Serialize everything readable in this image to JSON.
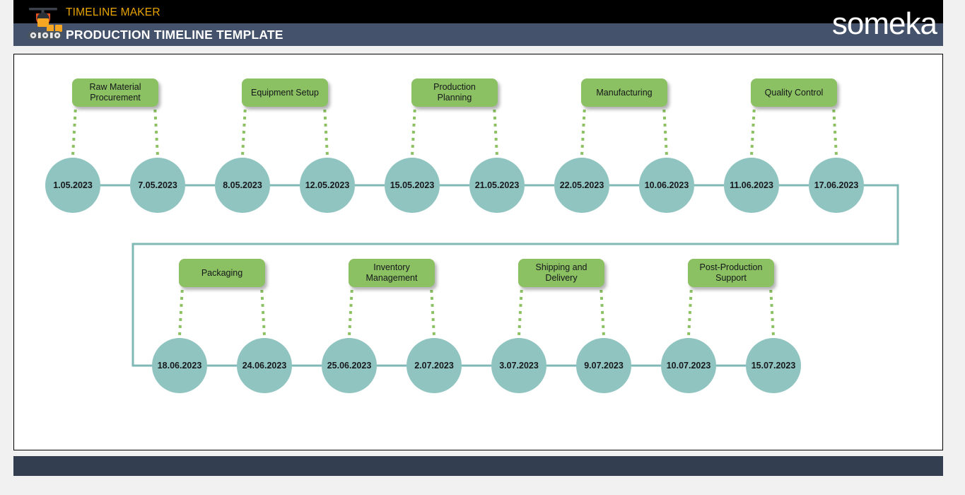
{
  "header": {
    "brand_kicker": "TIMELINE MAKER",
    "title": "PRODUCTION TIMELINE TEMPLATE",
    "wordmark_pre": "s",
    "wordmark_o": "o",
    "wordmark_post": "meka",
    "logo_icon": "factory-crane-icon",
    "chart_icon": "bar-chart-icon",
    "colors": {
      "kicker": "#e8a400",
      "black_band": "#000000",
      "slate_band": "#44536b",
      "footer": "#333f51"
    }
  },
  "timeline": {
    "colors": {
      "node_fill": "#8fc4c0",
      "milestone_fill": "#8cc163",
      "connector": "#7fb9b5",
      "dotted": "#8cc163"
    },
    "rows": [
      {
        "nodes": [
          {
            "date": "1.05.2023"
          },
          {
            "date": "7.05.2023"
          },
          {
            "date": "8.05.2023"
          },
          {
            "date": "12.05.2023"
          },
          {
            "date": "15.05.2023"
          },
          {
            "date": "21.05.2023"
          },
          {
            "date": "22.05.2023"
          },
          {
            "date": "10.06.2023"
          },
          {
            "date": "11.06.2023"
          },
          {
            "date": "17.06.2023"
          }
        ],
        "milestones": [
          {
            "label": "Raw Material Procurement",
            "start": 0,
            "end": 1
          },
          {
            "label": "Equipment Setup",
            "start": 2,
            "end": 3
          },
          {
            "label": "Production Planning",
            "start": 4,
            "end": 5
          },
          {
            "label": "Manufacturing",
            "start": 6,
            "end": 7
          },
          {
            "label": "Quality Control",
            "start": 8,
            "end": 9
          }
        ]
      },
      {
        "nodes": [
          {
            "date": "18.06.2023"
          },
          {
            "date": "24.06.2023"
          },
          {
            "date": "25.06.2023"
          },
          {
            "date": "2.07.2023"
          },
          {
            "date": "3.07.2023"
          },
          {
            "date": "9.07.2023"
          },
          {
            "date": "10.07.2023"
          },
          {
            "date": "15.07.2023"
          }
        ],
        "milestones": [
          {
            "label": "Packaging",
            "start": 0,
            "end": 1
          },
          {
            "label": "Inventory Management",
            "start": 2,
            "end": 3
          },
          {
            "label": "Shipping and Delivery",
            "start": 4,
            "end": 5
          },
          {
            "label": "Post-Production Support",
            "start": 6,
            "end": 7
          }
        ]
      }
    ]
  }
}
